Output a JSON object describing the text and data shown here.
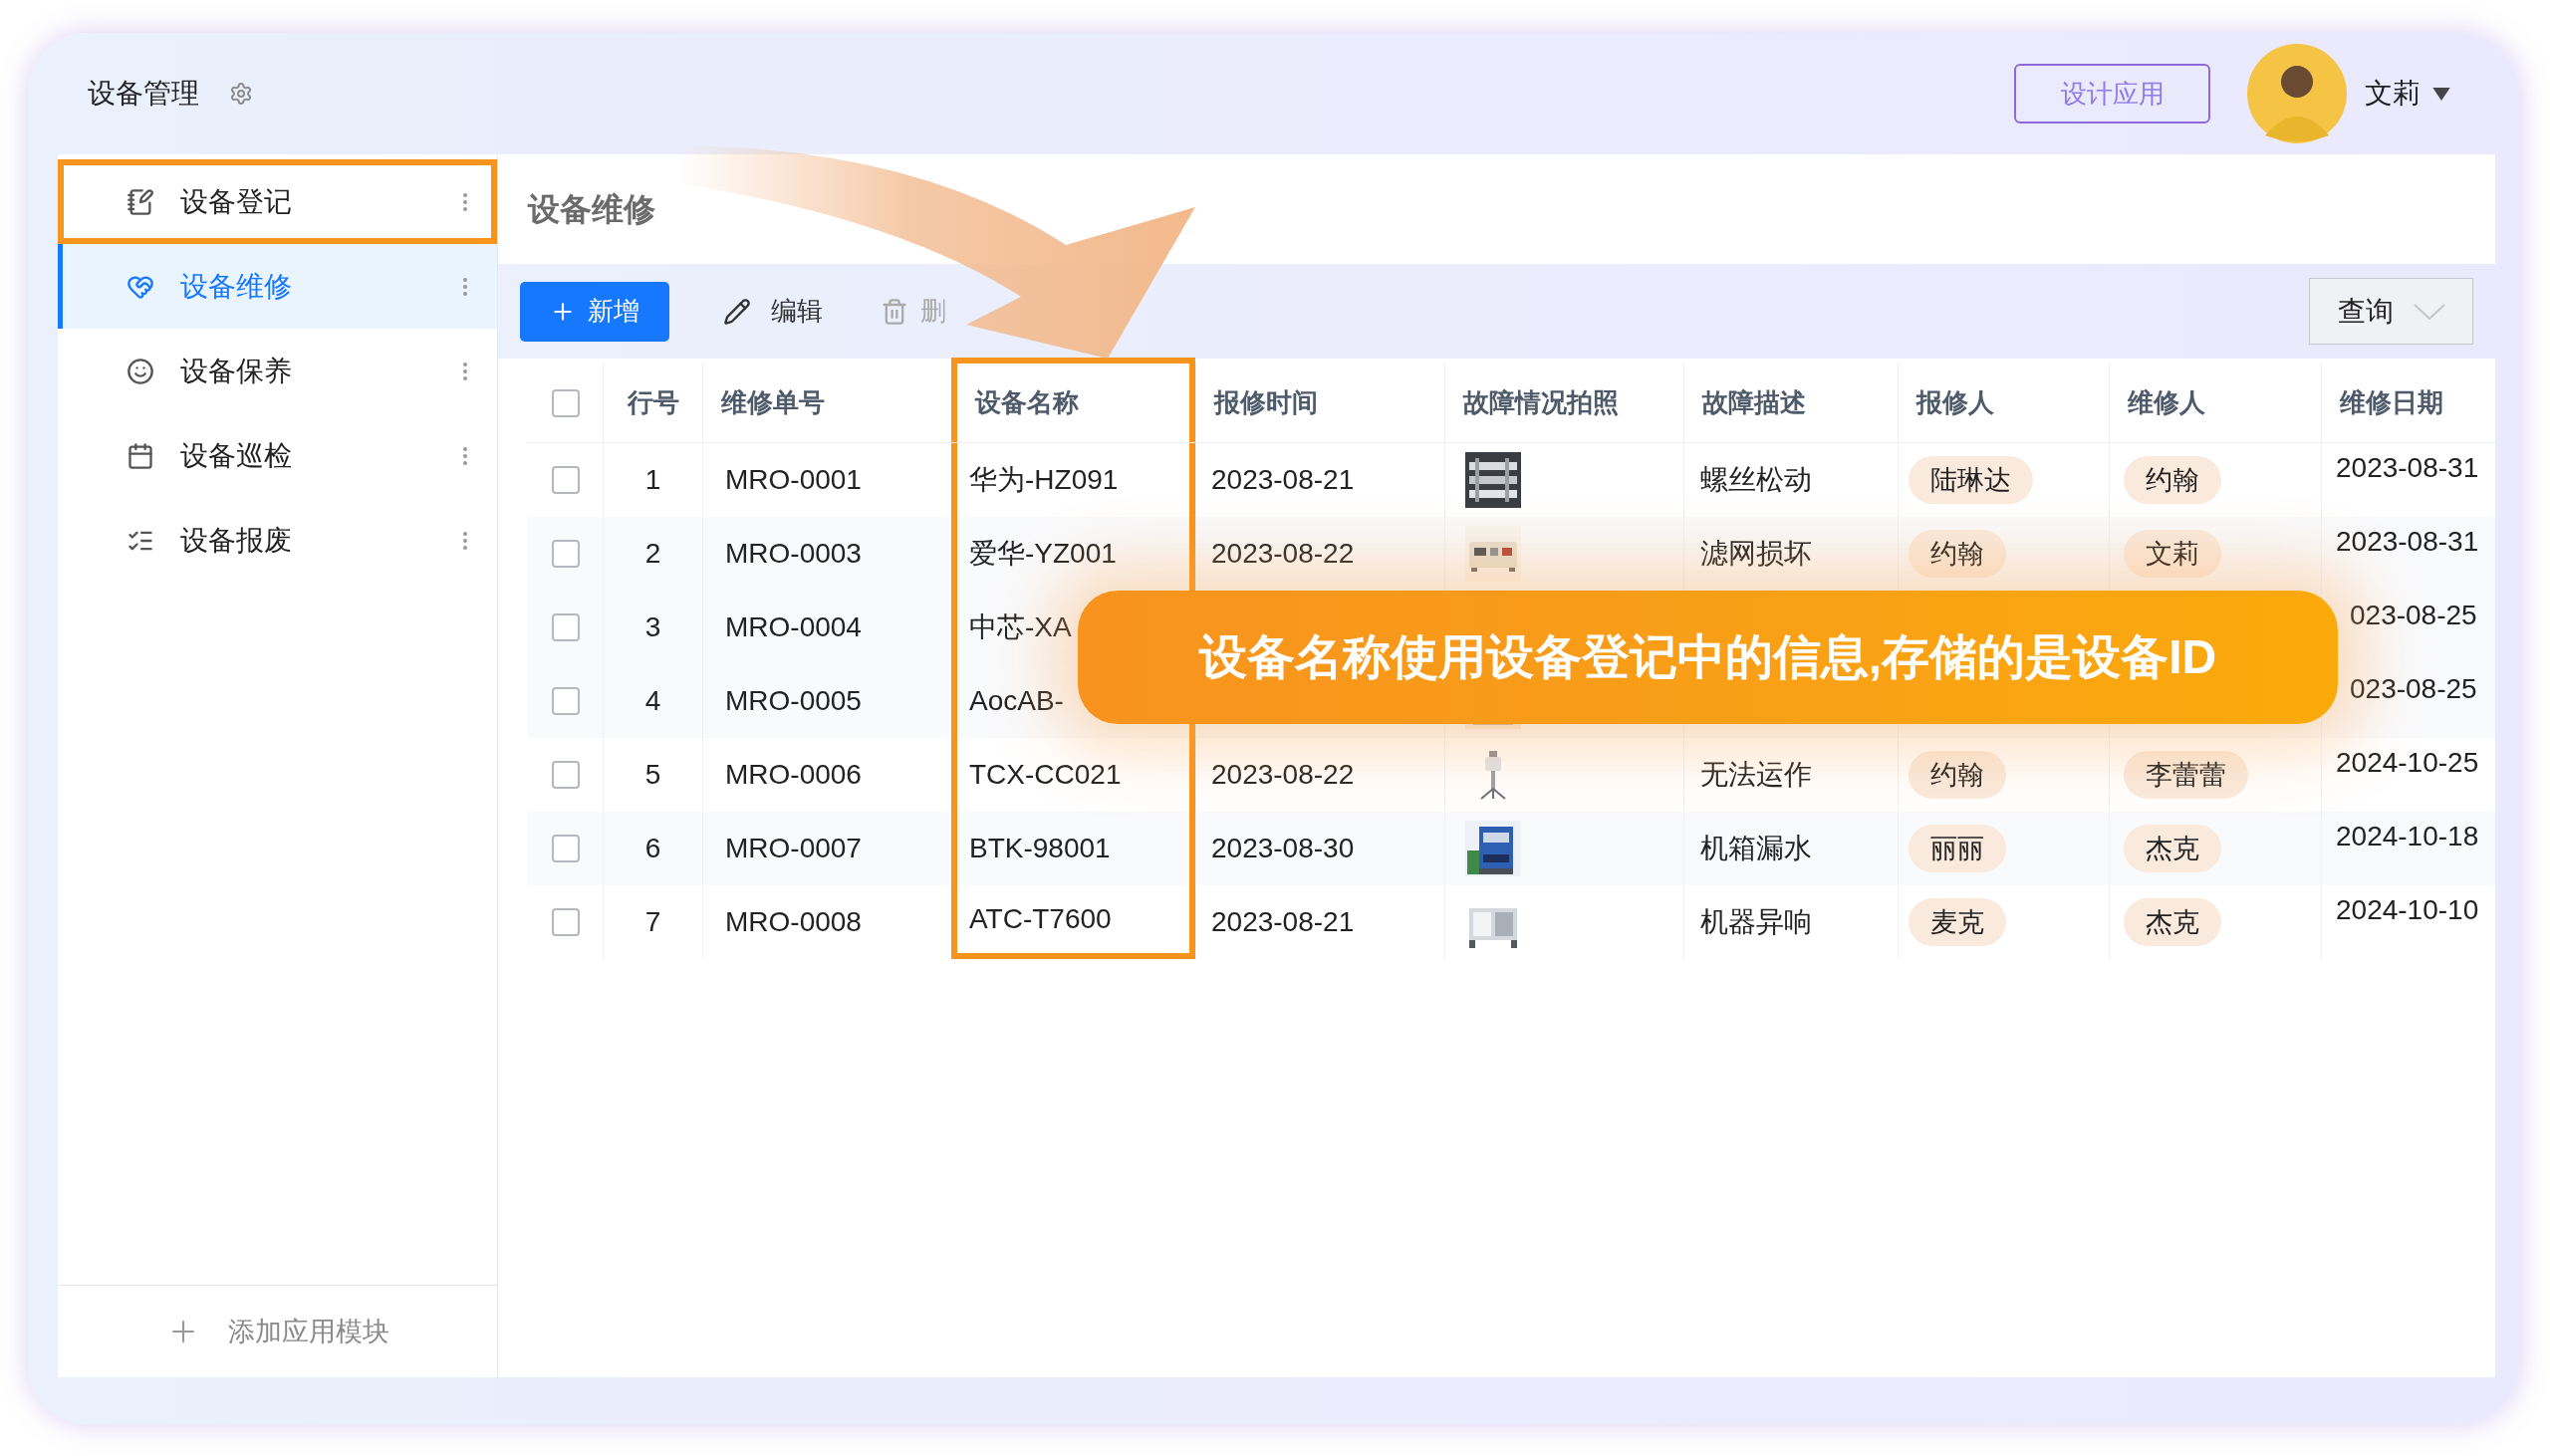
{
  "app": {
    "title": "设备管理"
  },
  "header": {
    "design_button": "设计应用",
    "user": {
      "name": "文莉"
    }
  },
  "sidebar": {
    "items": [
      {
        "label": "设备登记",
        "selected": false,
        "highlighted": true
      },
      {
        "label": "设备维修",
        "selected": true,
        "highlighted": false
      },
      {
        "label": "设备保养",
        "selected": false,
        "highlighted": false
      },
      {
        "label": "设备巡检",
        "selected": false,
        "highlighted": false
      },
      {
        "label": "设备报废",
        "selected": false,
        "highlighted": false
      }
    ],
    "add_module": "添加应用模块"
  },
  "page": {
    "title": "设备维修"
  },
  "toolbar": {
    "buttons": [
      {
        "kind": "primary",
        "label": "新增"
      },
      {
        "kind": "edit",
        "label": "编辑"
      },
      {
        "kind": "delete",
        "label": "删"
      }
    ],
    "query_button": "查询"
  },
  "table": {
    "select_all_checked": false,
    "columns": [
      {
        "label": "行号",
        "highlighted": false
      },
      {
        "label": "维修单号",
        "highlighted": false
      },
      {
        "label": "设备名称",
        "highlighted": true
      },
      {
        "label": "报修时间",
        "highlighted": false
      },
      {
        "label": "故障情况拍照",
        "highlighted": false
      },
      {
        "label": "故障描述",
        "highlighted": false
      },
      {
        "label": "报修人",
        "highlighted": false
      },
      {
        "label": "维修人",
        "highlighted": false
      },
      {
        "label": "维修日期",
        "highlighted": false
      }
    ],
    "rows": [
      {
        "checked": false,
        "no": "1",
        "order": "MRO-0001",
        "device": "华为-HZ091",
        "report_time": "2023-08-21",
        "fault": "螺丝松动",
        "reporter": "陆琳达",
        "repairer": "约翰",
        "repair_date": "2023-08-31"
      },
      {
        "checked": false,
        "no": "2",
        "order": "MRO-0003",
        "device": "爱华-YZ001",
        "report_time": "2023-08-22",
        "fault": "滤网损坏",
        "reporter": "约翰",
        "repairer": "文莉",
        "repair_date": "2023-08-31"
      },
      {
        "checked": false,
        "no": "3",
        "order": "MRO-0004",
        "device": "中芯-XA",
        "repair_date": "023-08-25"
      },
      {
        "checked": false,
        "no": "4",
        "order": "MRO-0005",
        "device": "AocAB-",
        "repair_date": "023-08-25"
      },
      {
        "checked": false,
        "no": "5",
        "order": "MRO-0006",
        "device": "TCX-CC021",
        "report_time": "2023-08-22",
        "fault": "无法运作",
        "reporter": "约翰",
        "repairer": "李蕾蕾",
        "repair_date": "2024-10-25"
      },
      {
        "checked": false,
        "no": "6",
        "order": "MRO-0007",
        "device": "BTK-98001",
        "report_time": "2023-08-30",
        "fault": "机箱漏水",
        "reporter": "丽丽",
        "repairer": "杰克",
        "repair_date": "2024-10-18"
      },
      {
        "checked": false,
        "no": "7",
        "order": "MRO-0008",
        "device": "ATC-T7600",
        "report_time": "2023-08-21",
        "fault": "机器异响",
        "reporter": "麦克",
        "repairer": "杰克",
        "repair_date": "2024-10-10"
      }
    ]
  },
  "callout": {
    "text": "设备名称使用设备登记中的信息,存储的是设备ID"
  }
}
